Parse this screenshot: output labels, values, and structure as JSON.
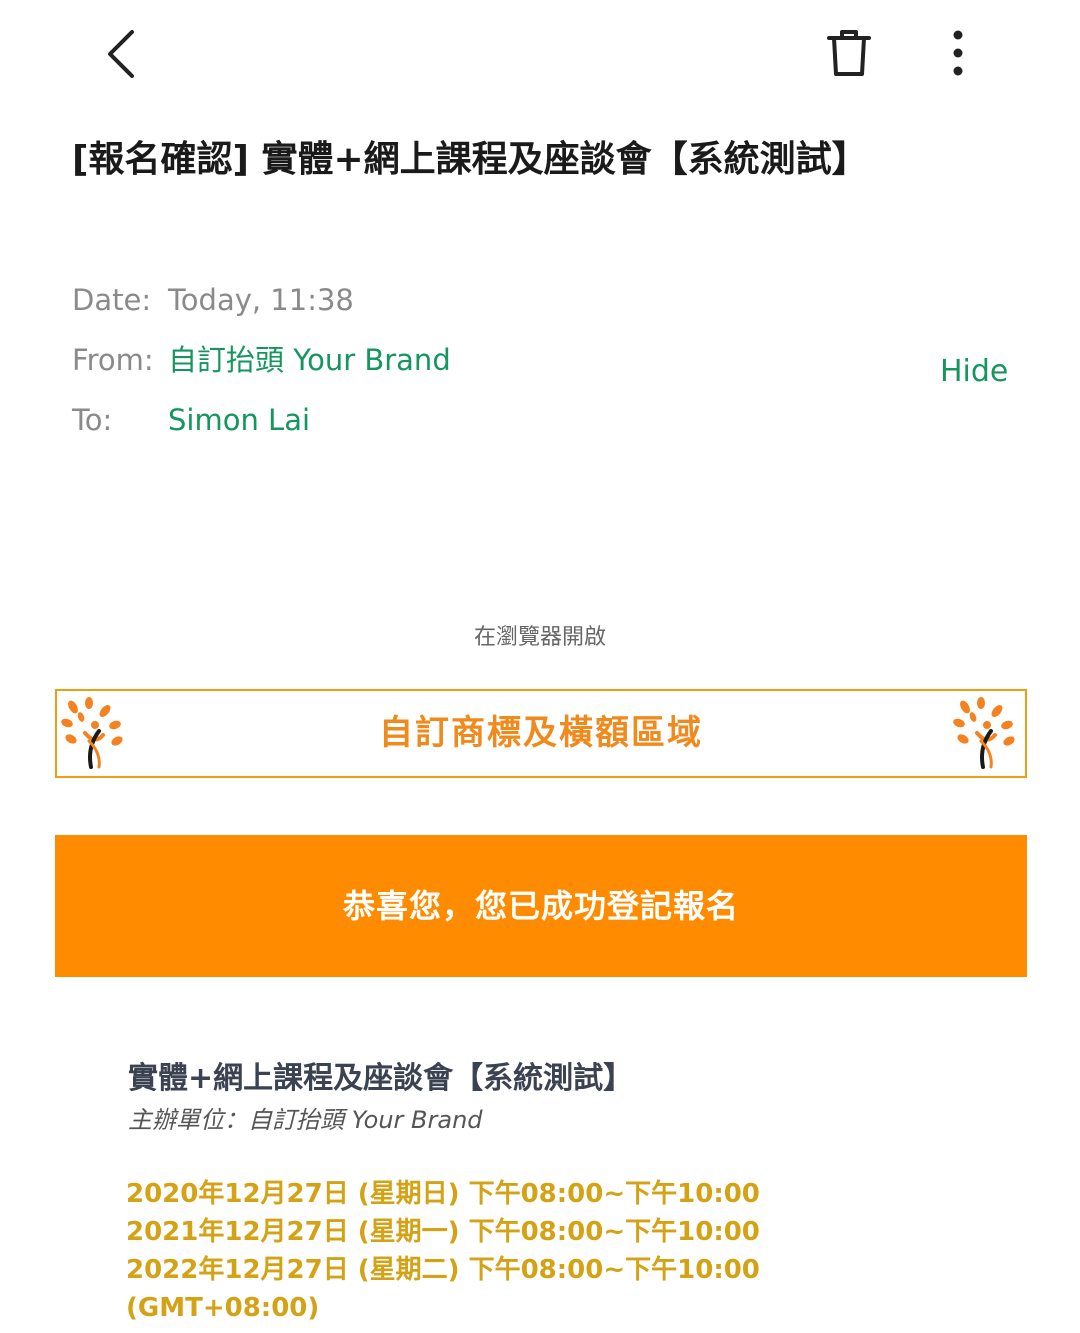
{
  "toolbar": {
    "back_icon": "chevron-left-icon",
    "delete_icon": "trash-icon",
    "more_icon": "more-vertical-icon"
  },
  "email": {
    "subject": "[報名確認] 實體+網上課程及座談會【系統測試】",
    "date_label": "Date:",
    "date_value": "Today, 11:38",
    "from_label": "From:",
    "from_value": "自訂抬頭 Your Brand",
    "to_label": "To:",
    "to_value": "Simon Lai",
    "hide_label": "Hide"
  },
  "body": {
    "open_in_browser": "在瀏覽器開啟",
    "banner_text": "自訂商標及橫額區域",
    "success_message": "恭喜您，您已成功登記報名",
    "event_title": "實體+網上課程及座談會【系統測試】",
    "organizer": "主辦單位：自訂抬頭 Your Brand",
    "dates": [
      "2020年12月27日 (星期日) 下午08:00~下午10:00",
      "2021年12月27日 (星期一) 下午08:00~下午10:00",
      "2022年12月27日 (星期二) 下午08:00~下午10:00",
      "(GMT+08:00)"
    ]
  },
  "colors": {
    "accent_green": "#16955f",
    "brand_orange": "#ff8c00",
    "banner_border": "#f39c12",
    "date_gold": "#d4a215"
  }
}
